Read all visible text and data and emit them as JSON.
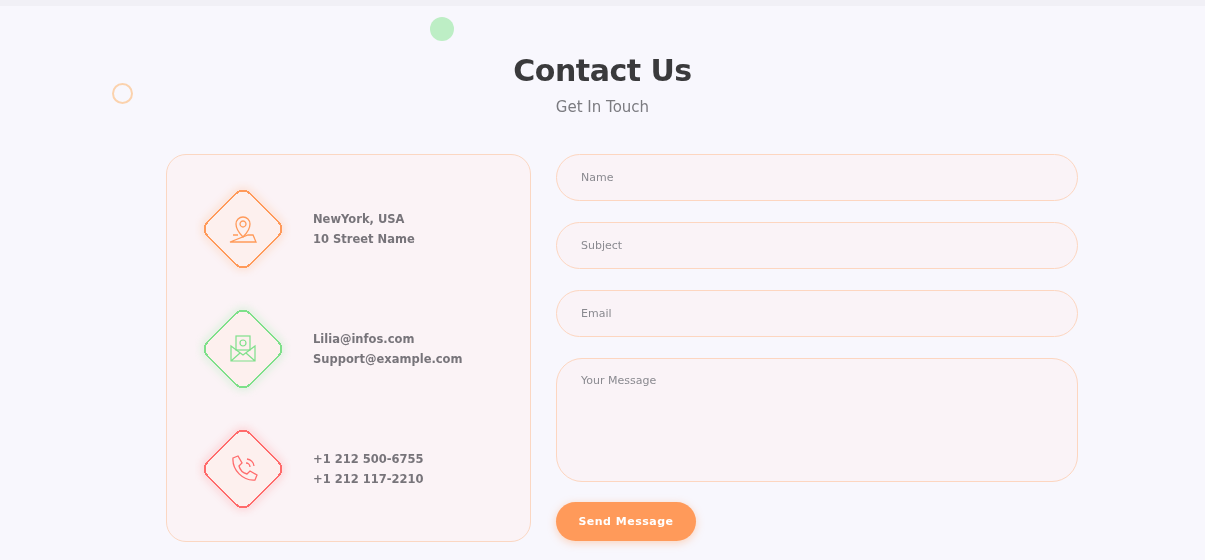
{
  "header": {
    "title": "Contact Us",
    "subtitle": "Get In Touch"
  },
  "contact_items": [
    {
      "kind": "address",
      "lines": [
        "NewYork, USA",
        "10 Street Name"
      ]
    },
    {
      "kind": "email",
      "lines": [
        "Lilia@infos.com",
        "Support@example.com"
      ]
    },
    {
      "kind": "phone",
      "lines": [
        "+1 212 500-6755",
        "+1 212 117-2210"
      ]
    }
  ],
  "form": {
    "fields": [
      {
        "kind": "input",
        "placeholder": "Name"
      },
      {
        "kind": "input",
        "placeholder": "Subject"
      },
      {
        "kind": "input",
        "placeholder": "Email"
      },
      {
        "kind": "textarea",
        "placeholder": "Your Message"
      }
    ],
    "submit": "Send Message"
  }
}
